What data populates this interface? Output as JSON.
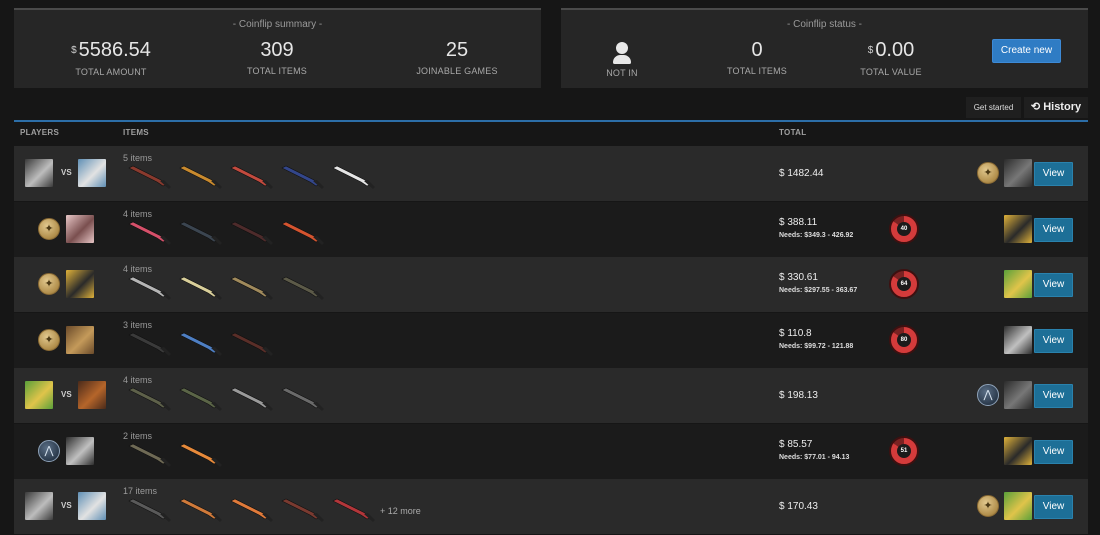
{
  "summary": {
    "title": "- Coinflip summary -",
    "total_amount": {
      "currency": "$",
      "value": "5586.54",
      "label": "TOTAL AMOUNT"
    },
    "total_items": {
      "value": "309",
      "label": "TOTAL ITEMS"
    },
    "joinable_games": {
      "value": "25",
      "label": "JOINABLE GAMES"
    }
  },
  "status": {
    "title": "- Coinflip status -",
    "not_in": {
      "label": "NOT IN",
      "icon": "user-icon"
    },
    "total_items": {
      "value": "0",
      "label": "TOTAL ITEMS"
    },
    "total_value": {
      "currency": "$",
      "value": "0.00",
      "label": "TOTAL VALUE"
    },
    "create_label": "Create new"
  },
  "controls": {
    "get_started": "Get started",
    "history": "History"
  },
  "table": {
    "headers": {
      "players": "PLAYERS",
      "items": "ITEMS",
      "total": "TOTAL"
    },
    "view_label": "View",
    "vs_label": "VS",
    "rows": [
      {
        "items_label": "5 items",
        "total": "$ 1482.44",
        "needs": "",
        "timer": "",
        "side": "t",
        "more": "",
        "skins": [
          "#8a3a2e",
          "#c98a2e",
          "#c24a3e",
          "#33468a",
          "#e6e6e6"
        ]
      },
      {
        "items_label": "4 items",
        "total": "$ 388.11",
        "needs": "Needs: $349.3 - 426.92",
        "timer": "40",
        "side": "",
        "more": "",
        "skins": [
          "#d6506a",
          "#3b4550",
          "#4e2b2b",
          "#d5542f"
        ]
      },
      {
        "items_label": "4 items",
        "total": "$ 330.61",
        "needs": "Needs: $297.55 - 363.67",
        "timer": "64",
        "side": "",
        "more": "",
        "skins": [
          "#b5b5b5",
          "#d9cf9a",
          "#a08a5c",
          "#5c5a48"
        ]
      },
      {
        "items_label": "3 items",
        "total": "$ 110.8",
        "needs": "Needs: $99.72 - 121.88",
        "timer": "80",
        "side": "",
        "more": "",
        "skins": [
          "#3a3a3a",
          "#4e7fc4",
          "#5a2e28"
        ]
      },
      {
        "items_label": "4 items",
        "total": "$ 198.13",
        "needs": "",
        "timer": "",
        "side": "ct",
        "more": "",
        "skins": [
          "#5e614a",
          "#5b6547",
          "#9a9a9a",
          "#6a6a6a"
        ]
      },
      {
        "items_label": "2 items",
        "total": "$ 85.57",
        "needs": "Needs: $77.01 - 94.13",
        "timer": "51",
        "side": "",
        "more": "",
        "skins": [
          "#6f6a55",
          "#e88a3a"
        ]
      },
      {
        "items_label": "17 items",
        "total": "$ 170.43",
        "needs": "",
        "timer": "",
        "side": "t",
        "more": "+ 12 more",
        "skins": [
          "#5a5a5a",
          "#d07a3a",
          "#e07a3a",
          "#7a3a30",
          "#b2363a"
        ]
      }
    ]
  }
}
